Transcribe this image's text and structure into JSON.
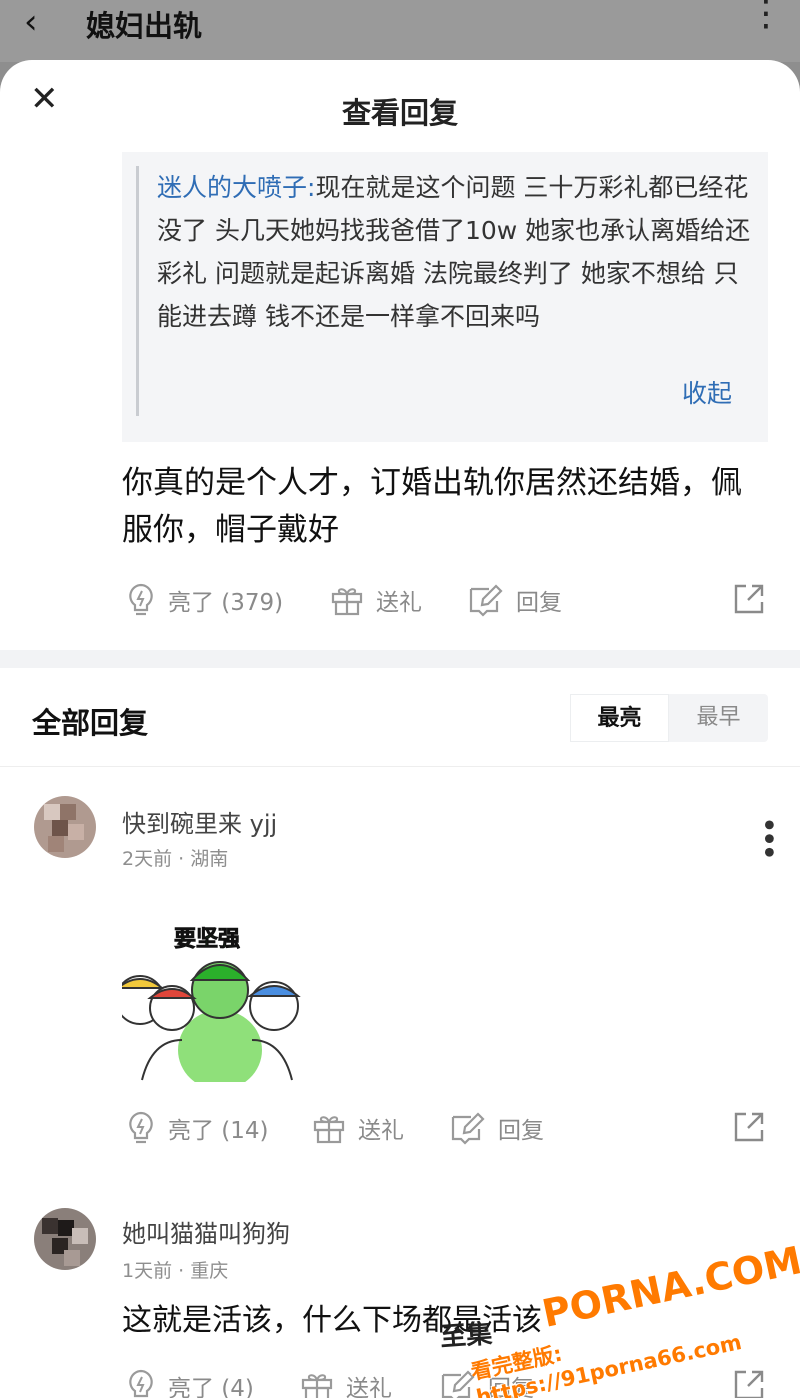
{
  "topbar": {
    "back_icon": "chevron-left-icon",
    "title": "媳妇出轨",
    "more_icon": "more-vertical-icon"
  },
  "sheet": {
    "title": "查看回复",
    "close_icon": "close-icon"
  },
  "quote": {
    "author": "迷人的大喷子:",
    "text": "现在就是这个问题 三十万彩礼都已经花没了 头几天她妈找我爸借了10w 她家也承认离婚给还彩礼 问题就是起诉离婚 法院最终判了 她家不想给 只能进去蹲 钱不还是一样拿不回来吗",
    "collapse_label": "收起"
  },
  "main_comment": {
    "text": "你真的是个人才，订婚出轨你居然还结婚，佩服你，帽子戴好",
    "actions": {
      "like_label": "亮了 (379)",
      "gift_label": "送礼",
      "reply_label": "回复"
    }
  },
  "all_replies": {
    "title": "全部回复",
    "sort_options": [
      "最亮",
      "最早"
    ],
    "selected_sort": "最亮"
  },
  "replies": [
    {
      "username": "快到碗里来 yjj",
      "meta": "2天前 · 湖南",
      "sticker_text": "要坚强",
      "actions": {
        "like_label": "亮了 (14)",
        "gift_label": "送礼",
        "reply_label": "回复"
      }
    },
    {
      "username": "她叫猫猫叫狗狗",
      "meta": "1天前 · 重庆",
      "text": "这就是活该，什么下场都是活该",
      "actions": {
        "like_label": "亮了 (4)",
        "gift_label": "送礼",
        "reply_label": "回复"
      }
    }
  ],
  "watermark": {
    "brand": "PORNA.COM",
    "url": "看完整版: https://91porna66.com",
    "overlay": "至集"
  },
  "colors": {
    "link_blue": "#2f6db5",
    "muted_gray": "#8a8a8a",
    "watermark_orange": "#ff7a00"
  }
}
